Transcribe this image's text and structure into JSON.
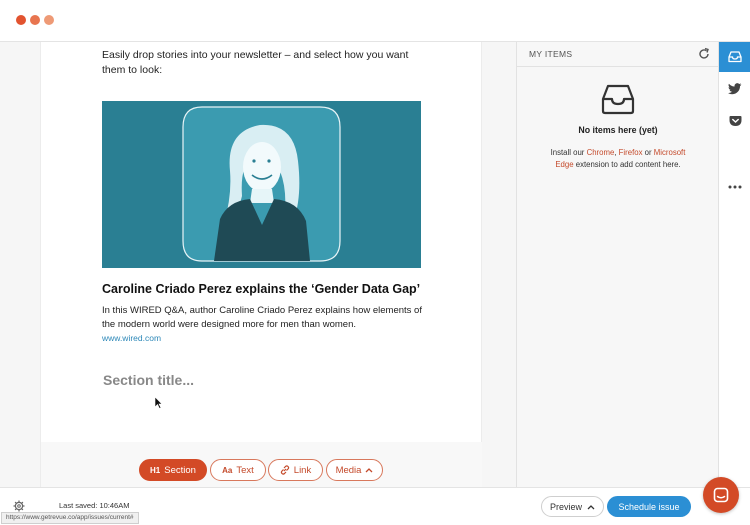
{
  "window": {
    "traffic_lights": [
      "#e2532f",
      "#e8754f",
      "#ee9a76"
    ]
  },
  "editor": {
    "intro_text": "Easily drop stories into your newsletter – and select how you want them to look:",
    "story": {
      "title": "Caroline Criado Perez explains the ‘Gender Data Gap’",
      "description": "In this WIRED Q&A, author Caroline Criado Perez explains how elements of the modern world were designed more for men than women.",
      "link": "www.wired.com",
      "image_color": "#2a7f93"
    },
    "section_placeholder": "Section title..."
  },
  "toolbar": {
    "section_icon": "H1",
    "section_label": "Section",
    "text_icon": "Aa",
    "text_label": "Text",
    "link_label": "Link",
    "media_label": "Media"
  },
  "panel": {
    "title": "MY ITEMS",
    "empty_title": "No items here (yet)",
    "install_prefix": "Install our",
    "chrome": "Chrome",
    "sep1": ",",
    "firefox": "Firefox",
    "or_word": "or",
    "edge": "Microsoft Edge",
    "install_suffix": "extension to add content here."
  },
  "rail": {
    "icons": [
      "inbox-icon",
      "twitter-icon",
      "pocket-icon",
      "more-icon"
    ],
    "active_color": "#2b8fd4"
  },
  "footer": {
    "last_saved": "Last saved: 10:46AM",
    "url_tooltip": "https://www.getrevue.co/app/issues/current#",
    "preview_label": "Preview",
    "schedule_label": "Schedule issue",
    "accent": "#d34a26"
  }
}
